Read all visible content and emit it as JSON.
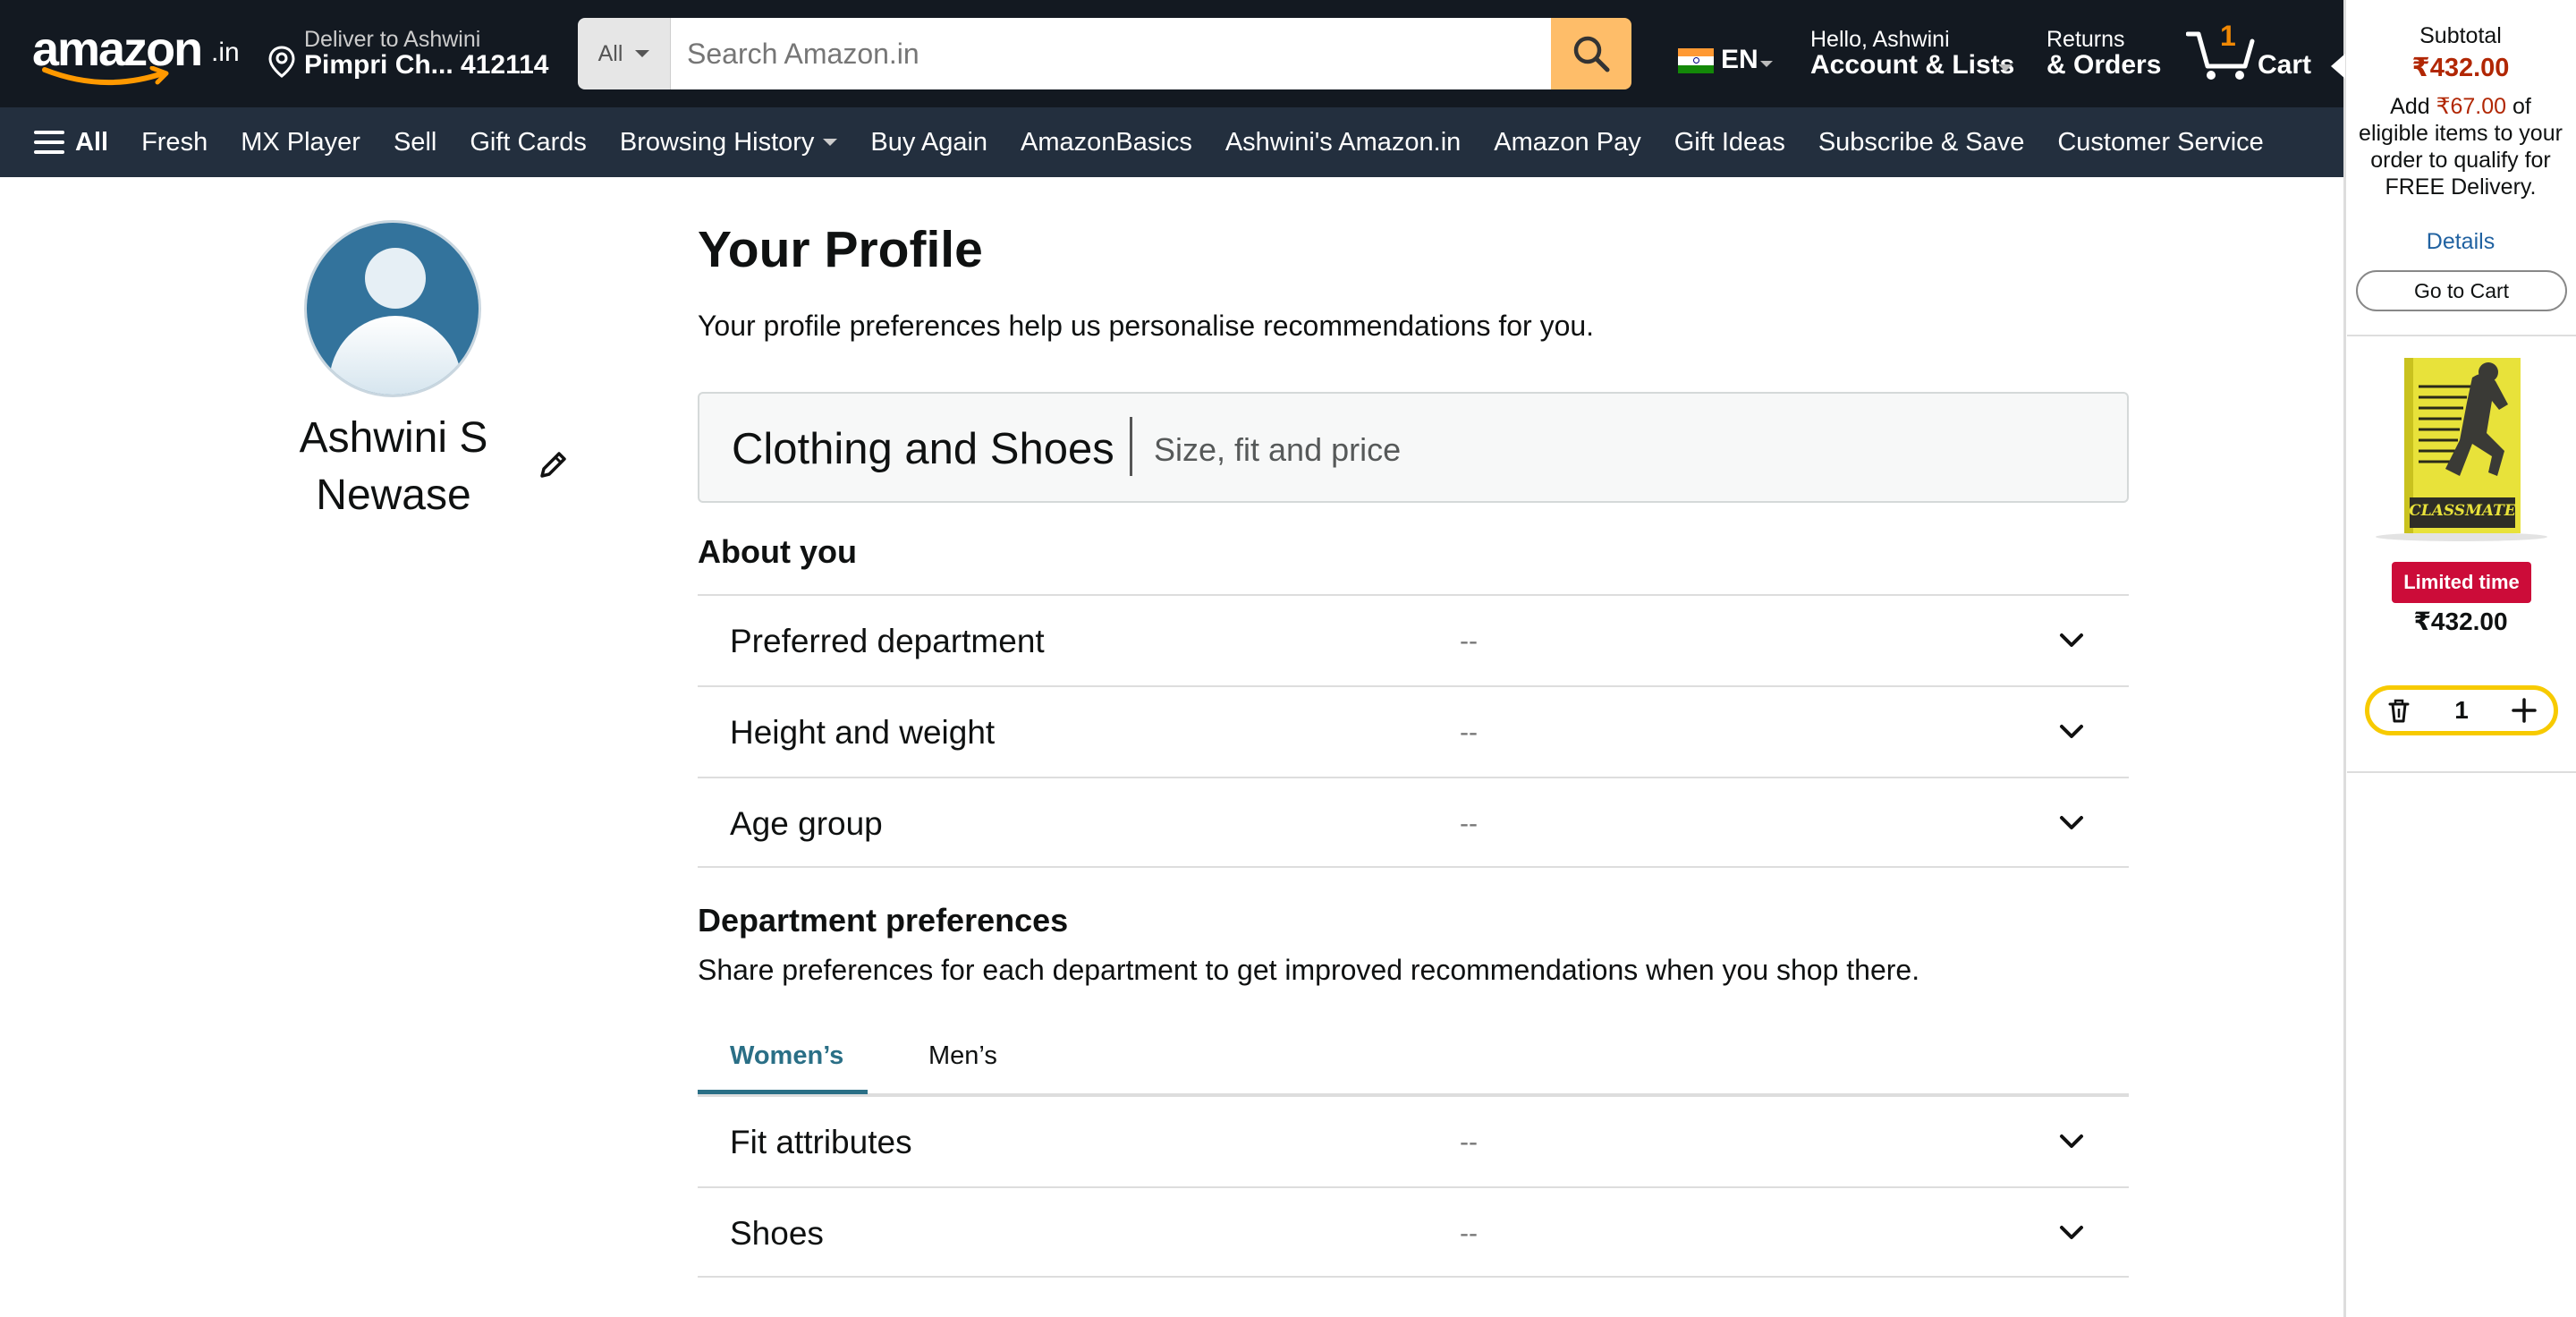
{
  "header": {
    "logo": "amazon",
    "logo_suffix": ".in",
    "deliver_to": "Deliver to Ashwini",
    "location": "Pimpri Ch... 412114",
    "search_category": "All",
    "search_placeholder": "Search Amazon.in",
    "language": "EN",
    "greeting": "Hello, Ashwini",
    "account_label": "Account & Lists",
    "returns_label": "Returns",
    "orders_label": "& Orders",
    "cart_count": "1",
    "cart_label": "Cart"
  },
  "nav": {
    "all": "All",
    "items": [
      "Fresh",
      "MX Player",
      "Sell",
      "Gift Cards",
      "Browsing History",
      "Buy Again",
      "AmazonBasics",
      "Ashwini's Amazon.in",
      "Amazon Pay",
      "Gift Ideas",
      "Subscribe & Save",
      "Customer Service"
    ]
  },
  "profile": {
    "name": "Ashwini S Newase"
  },
  "main": {
    "title": "Your Profile",
    "subtitle": "Your profile preferences help us personalise recommendations for you.",
    "category_title": "Clothing and Shoes",
    "category_sub": "Size, fit and price",
    "about_heading": "About you",
    "about_rows": [
      {
        "label": "Preferred department",
        "value": "--"
      },
      {
        "label": "Height and weight",
        "value": "--"
      },
      {
        "label": "Age group",
        "value": "--"
      }
    ],
    "dept_heading": "Department preferences",
    "dept_sub": "Share preferences for each department to get improved recommendations when you shop there.",
    "tabs": [
      "Women’s",
      "Men’s"
    ],
    "dept_rows": [
      {
        "label": "Fit attributes",
        "value": "--"
      },
      {
        "label": "Shoes",
        "value": "--"
      }
    ]
  },
  "cart_panel": {
    "subtotal_label": "Subtotal",
    "subtotal_value": "₹432.00",
    "add_prefix": "Add",
    "add_amount": "₹67.00",
    "add_suffix": "of eligible items to your order to qualify for FREE Delivery.",
    "details": "Details",
    "go_to_cart": "Go to Cart",
    "product_brand": "CLASSMATE",
    "badge": "Limited time",
    "price": "₹432.00",
    "quantity": "1"
  },
  "colors": {
    "topbar": "#131921",
    "navbar": "#232f3e",
    "search_button": "#febd69",
    "price_red": "#b12704",
    "tab_active": "#2a6f86",
    "badge": "#cc0c39",
    "qty_border": "#f7ca00"
  }
}
